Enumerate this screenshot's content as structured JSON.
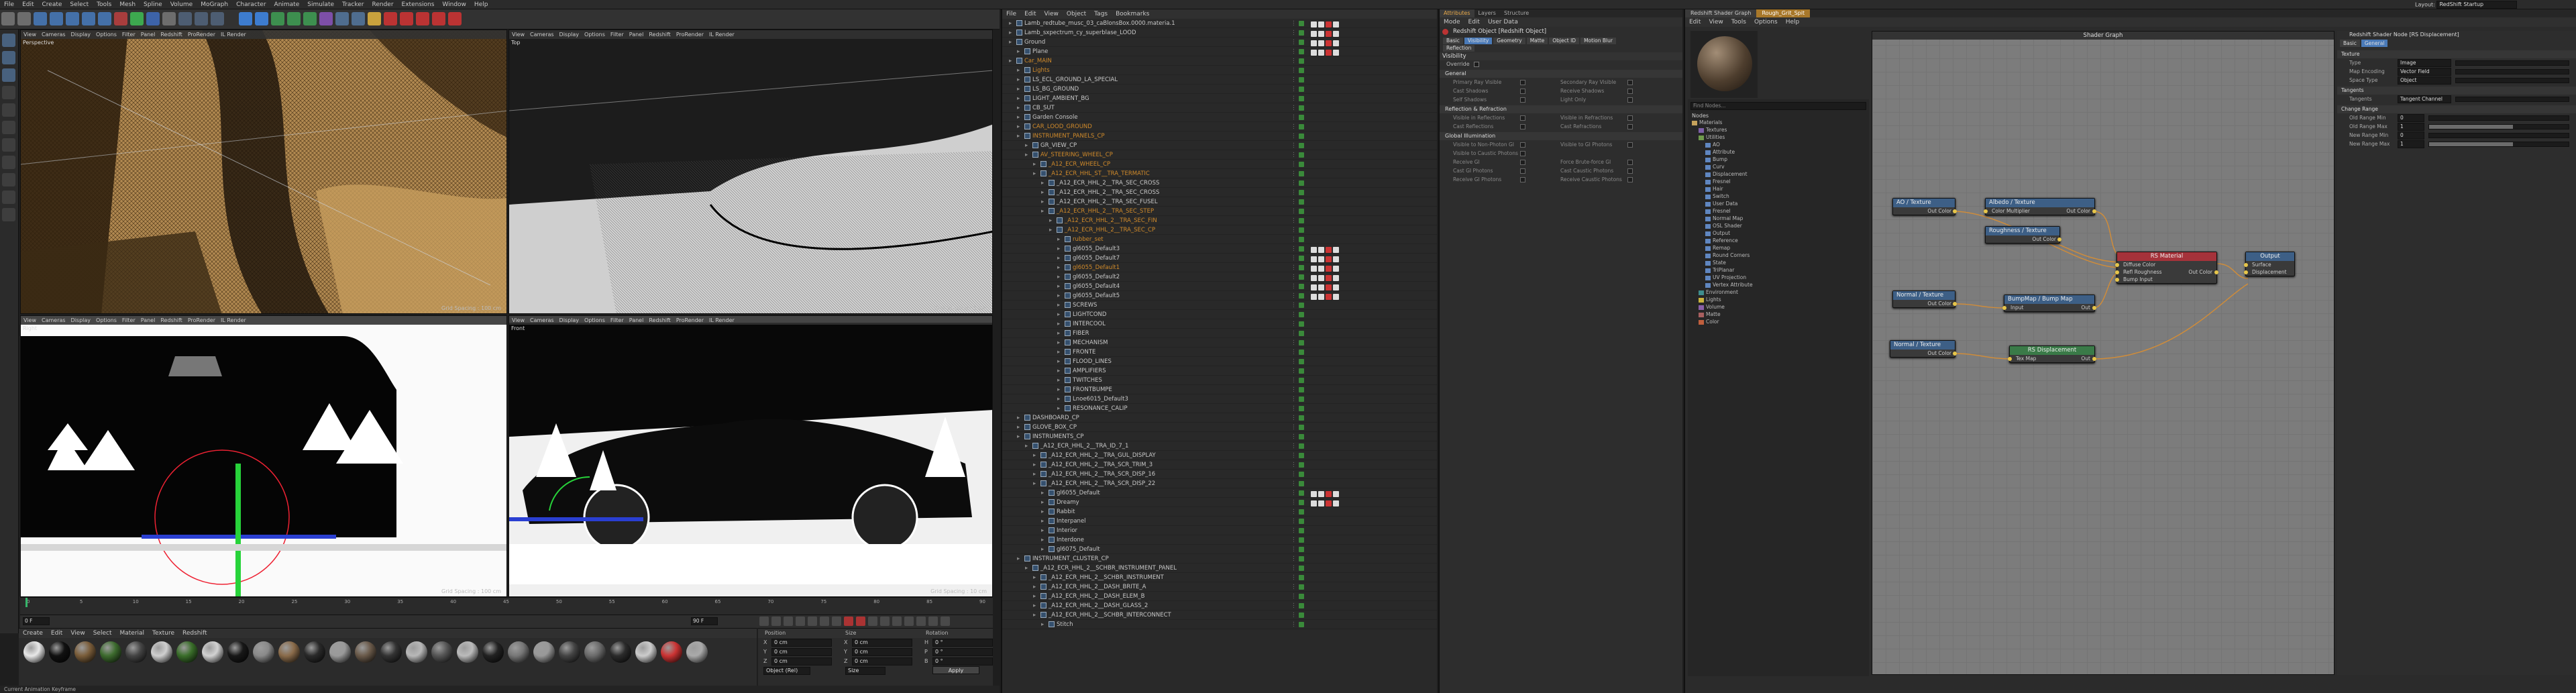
{
  "menus": {
    "main": [
      "File",
      "Edit",
      "Create",
      "Select",
      "Tools",
      "Mesh",
      "Spline",
      "Volume",
      "MoGraph",
      "Character",
      "Animate",
      "Simulate",
      "Tracker",
      "Render",
      "Extensions",
      "Window",
      "Help"
    ],
    "layout_label": "Layout:",
    "layout_value": "RedShift Startup"
  },
  "viewports": {
    "menu": [
      "View",
      "Cameras",
      "Display",
      "Options",
      "Filter",
      "Panel",
      "Redshift",
      "ProRender",
      "IL Render"
    ],
    "v1": {
      "label": "Perspective",
      "grid": "Grid Spacing : 100 cm"
    },
    "v2": {
      "label": "Top",
      "grid": "Grid Spacing : 1 cm"
    },
    "v3": {
      "label": "Right",
      "grid": "Grid Spacing : 100 cm"
    },
    "v4": {
      "label": "Front",
      "grid": "Grid Spacing : 10 cm"
    }
  },
  "timeline": {
    "start": "0 F",
    "end": "90 F",
    "current": "0 F",
    "ticks": [
      "0",
      "5",
      "10",
      "15",
      "20",
      "25",
      "30",
      "35",
      "40",
      "45",
      "50",
      "55",
      "60",
      "65",
      "70",
      "75",
      "80",
      "85",
      "90"
    ]
  },
  "material_manager": {
    "menu": [
      "Create",
      "Edit",
      "View",
      "Select",
      "Material",
      "Texture",
      "Redshift"
    ]
  },
  "coordinates": {
    "headers": [
      "Position",
      "Size",
      "Rotation"
    ],
    "rows": [
      [
        "X",
        "0 cm",
        "X",
        "0 cm",
        "H",
        "0 °"
      ],
      [
        "Y",
        "0 cm",
        "Y",
        "0 cm",
        "P",
        "0 °"
      ],
      [
        "Z",
        "0 cm",
        "Z",
        "0 cm",
        "B",
        "0 °"
      ]
    ],
    "mode": "Object (Rel)",
    "size_mode": "Size",
    "apply": "Apply"
  },
  "status": {
    "text": "Current Animation Keyframe"
  },
  "objects": {
    "menu": [
      "File",
      "Edit",
      "View",
      "Object",
      "Tags",
      "Bookmarks"
    ],
    "rows": [
      {
        "name": "Lamb_redtube_musc_03_caBlonsBox.0000.materia.1",
        "depth": 0,
        "c": "w"
      },
      {
        "name": "Lamb_sxpectrum_cy_superblase_LOOD",
        "depth": 0,
        "c": "w"
      },
      {
        "name": "Ground",
        "depth": 0,
        "c": "w"
      },
      {
        "name": "Plane",
        "depth": 1,
        "c": "w"
      },
      {
        "name": "Car_MAIN",
        "depth": 0,
        "c": "o"
      },
      {
        "name": "Lights",
        "depth": 1,
        "c": "o"
      },
      {
        "name": "LS_ECL_GROUND_LA_SPECIAL",
        "depth": 1,
        "c": "w"
      },
      {
        "name": "LS_BG_GROUND",
        "depth": 1,
        "c": "w"
      },
      {
        "name": "LIGHT_AMBIENT_BG",
        "depth": 1,
        "c": "w"
      },
      {
        "name": "CB_SUT",
        "depth": 1,
        "c": "w"
      },
      {
        "name": "Garden Console",
        "depth": 1,
        "c": "w"
      },
      {
        "name": "CAR_LOOD_GROUND",
        "depth": 1,
        "c": "o"
      },
      {
        "name": "INSTRUMENT_PANELS_CP",
        "depth": 1,
        "c": "o"
      },
      {
        "name": "GR_VIEW_CP",
        "depth": 2,
        "c": "w"
      },
      {
        "name": "AV_STEERING_WHEEL_CP",
        "depth": 2,
        "c": "o"
      },
      {
        "name": "_A12_ECR_WHEEL_CP",
        "depth": 3,
        "c": "o"
      },
      {
        "name": "_A12_ECR_HHL_ST__TRA_TERMATIC",
        "depth": 3,
        "c": "o"
      },
      {
        "name": "_A12_ECR_HHL_2__TRA_SEC_CROSS",
        "depth": 4,
        "c": "w"
      },
      {
        "name": "_A12_ECR_HHL_2__TRA_SEC_CROSS",
        "depth": 4,
        "c": "w"
      },
      {
        "name": "_A12_ECR_HHL_2__TRA_SEC_FUSEL",
        "depth": 4,
        "c": "w"
      },
      {
        "name": "_A12_ECR_HHL_2__TRA_SEC_STEP",
        "depth": 4,
        "c": "o"
      },
      {
        "name": "_A12_ECR_HHL_2__TRA_SEC_FIN",
        "depth": 5,
        "c": "o"
      },
      {
        "name": "_A12_ECR_HHL_2__TRA_SEC_CP",
        "depth": 5,
        "c": "o"
      },
      {
        "name": "rubber_set",
        "depth": 6,
        "c": "o"
      },
      {
        "name": "gl6055_Default3",
        "depth": 6,
        "c": "w"
      },
      {
        "name": "gl6055_Default7",
        "depth": 6,
        "c": "w"
      },
      {
        "name": "gl6055_Default1",
        "depth": 6,
        "c": "o"
      },
      {
        "name": "gl6055_Default2",
        "depth": 6,
        "c": "w"
      },
      {
        "name": "gl6055_Default4",
        "depth": 6,
        "c": "w"
      },
      {
        "name": "gl6055_Default5",
        "depth": 6,
        "c": "w"
      },
      {
        "name": "SCREWS",
        "depth": 6,
        "c": "w"
      },
      {
        "name": "LIGHTCOND",
        "depth": 6,
        "c": "w"
      },
      {
        "name": "INTERCOOL",
        "depth": 6,
        "c": "w"
      },
      {
        "name": "FIBER",
        "depth": 6,
        "c": "w"
      },
      {
        "name": "MECHANISM",
        "depth": 6,
        "c": "w"
      },
      {
        "name": "FRONTE",
        "depth": 6,
        "c": "w"
      },
      {
        "name": "FLOOD_LINES",
        "depth": 6,
        "c": "w"
      },
      {
        "name": "AMPLIFIERS",
        "depth": 6,
        "c": "w"
      },
      {
        "name": "TWITCHES",
        "depth": 6,
        "c": "w"
      },
      {
        "name": "FRONTBUMPE",
        "depth": 6,
        "c": "w"
      },
      {
        "name": "Lnoe6015_Default3",
        "depth": 6,
        "c": "w"
      },
      {
        "name": "RESONANCE_CALIP",
        "depth": 6,
        "c": "w"
      },
      {
        "name": "DASHBOARD_CP",
        "depth": 1,
        "c": "w"
      },
      {
        "name": "GLOVE_BOX_CP",
        "depth": 1,
        "c": "w"
      },
      {
        "name": "INSTRUMENTS_CP",
        "depth": 1,
        "c": "w"
      },
      {
        "name": "_A12_ECR_HHL_2__TRA_ID_7_1",
        "depth": 2,
        "c": "w"
      },
      {
        "name": "_A12_ECR_HHL_2__TRA_GUL_DISPLAY",
        "depth": 3,
        "c": "w"
      },
      {
        "name": "_A12_ECR_HHL_2__TRA_SCR_TRIM_3",
        "depth": 3,
        "c": "w"
      },
      {
        "name": "_A12_ECR_HHL_2__TRA_SCR_DISP_16",
        "depth": 3,
        "c": "w"
      },
      {
        "name": "_A12_ECR_HHL_2__TRA_SCR_DISP_22",
        "depth": 3,
        "c": "w"
      },
      {
        "name": "gl6055_Default",
        "depth": 4,
        "c": "w"
      },
      {
        "name": "Dreamy",
        "depth": 4,
        "c": "w"
      },
      {
        "name": "Rabbit",
        "depth": 4,
        "c": "w"
      },
      {
        "name": "Interpanel",
        "depth": 4,
        "c": "w"
      },
      {
        "name": "Interior",
        "depth": 4,
        "c": "w"
      },
      {
        "name": "Interdone",
        "depth": 4,
        "c": "w"
      },
      {
        "name": "gl6075_Default",
        "depth": 4,
        "c": "w"
      },
      {
        "name": "INSTRUMENT_CLUSTER_CP",
        "depth": 1,
        "c": "w"
      },
      {
        "name": "_A12_ECR_HHL_2__SCHBR_INSTRUMENT_PANEL",
        "depth": 2,
        "c": "w"
      },
      {
        "name": "_A12_ECR_HHL_2__SCHBR_INSTRUMENT",
        "depth": 3,
        "c": "w"
      },
      {
        "name": "_A12_ECR_HHL_2__DASH_BRITE_A",
        "depth": 3,
        "c": "w"
      },
      {
        "name": "_A12_ECR_HHL_2__DASH_ELEM_B",
        "depth": 3,
        "c": "w"
      },
      {
        "name": "_A12_ECR_HHL_2__DASH_GLASS_2",
        "depth": 3,
        "c": "w"
      },
      {
        "name": "_A12_ECR_HHL_2__SCHBR_INTERCONNECT",
        "depth": 3,
        "c": "w"
      },
      {
        "name": "Stitch",
        "depth": 4,
        "c": "w"
      }
    ]
  },
  "attributes": {
    "tabs": [
      "Attributes",
      "Layers",
      "Structure"
    ],
    "menu": [
      "Mode",
      "Edit",
      "User Data"
    ],
    "title": "Redshift Object [Redshift Object]",
    "subtabs": [
      "Basic",
      "Visibility",
      "Geometry",
      "Matte",
      "Object ID",
      "Motion Blur"
    ],
    "subtab2": [
      "Reflection"
    ],
    "section": "Visibility",
    "override_label": "Override",
    "groups": [
      {
        "title": "General",
        "fields": [
          [
            "Primary Ray Visible",
            "Secondary Ray Visible"
          ],
          [
            "Cast Shadows",
            "Receive Shadows"
          ],
          [
            "Self Shadows",
            "Light Only"
          ]
        ]
      },
      {
        "title": "Reflection & Refraction",
        "fields": [
          [
            "Visible in Reflections",
            "Visible in Refractions"
          ],
          [
            "Cast Reflections",
            "Cast Refractions"
          ]
        ]
      },
      {
        "title": "Global Illumination",
        "fields": [
          [
            "Visible to Non-Photon GI",
            "Visible to GI Photons"
          ],
          [
            "Visible to Caustic Photons",
            ""
          ],
          [
            "Receive GI",
            "Force Brute-force GI"
          ],
          [
            "Cast GI Photons",
            "Cast Caustic Photons"
          ],
          [
            "Receive GI Photons",
            "Receive Caustic Photons"
          ]
        ]
      }
    ]
  },
  "material_editor": {
    "tabs": [
      "Redshift Shader Graph",
      "Rough_Grit_Spit"
    ],
    "menu": [
      "Edit",
      "View",
      "Tools",
      "Options",
      "Help"
    ],
    "find_placeholder": "Find Nodes...",
    "tree_title": "Nodes",
    "tree": [
      "Materials",
      "Textures",
      "Utilities",
      "AO",
      "Attribute",
      "Bump",
      "Curv",
      "Displacement",
      "Fresnel",
      "Hair",
      "Switch",
      "User Data",
      "Fresnel",
      "Normal Map",
      "OSL Shader",
      "Output",
      "Reference",
      "Remap",
      "Round Corners",
      "State",
      "TriPlanar",
      "UV Projection",
      "Vertex Attribute",
      "Environment",
      "Lights",
      "Volume",
      "Matte",
      "Color"
    ],
    "graph_title": "Shader Graph",
    "nodes": {
      "ao": {
        "title": "AO / Texture",
        "out": "Out Color"
      },
      "albedo": {
        "title": "Albedo / Texture",
        "in": "Color Multiplier",
        "out": "Out Color"
      },
      "rough": {
        "title": "Roughness / Texture",
        "out": "Out Color"
      },
      "material": {
        "title": "RS Material",
        "ports": [
          "Diffuse Color",
          "Refl Roughness",
          "Bump Input"
        ],
        "out": "Out Color"
      },
      "output": {
        "title": "Output",
        "ports": [
          "Surface",
          "Displacement"
        ]
      },
      "normal": {
        "title": "Normal / Texture",
        "out": "Out Color"
      },
      "bumpmap": {
        "title": "BumpMap / Bump Map",
        "in": "Input",
        "out": "Out"
      },
      "normal2": {
        "title": "Normal / Texture",
        "out": "Out Color"
      },
      "disp": {
        "title": "RS Displacement",
        "in": "Tex Map",
        "out": "Out"
      }
    }
  },
  "properties": {
    "title": "Redshift Shader Node [RS Displacement]",
    "tabs": [
      "Basic",
      "General"
    ],
    "group1": "Texture",
    "fields1": [
      [
        "Type",
        "Image"
      ],
      [
        "Map Encoding",
        "Vector Field"
      ],
      [
        "Space Type",
        "Object"
      ]
    ],
    "group2": "Tangents",
    "fields2": [
      [
        "Tangents",
        "Tangent Channel"
      ]
    ],
    "group3": "Change Range",
    "fields3": [
      [
        "Old Range Min",
        "0",
        0.0
      ],
      [
        "Old Range Max",
        "1",
        0.6
      ],
      [
        "New Range Min",
        "0",
        0.0
      ],
      [
        "New Range Max",
        "1",
        0.6
      ]
    ]
  },
  "colors": {
    "accent": "#d08a2a",
    "node_header_blue": "#3d5f86",
    "node_header_red": "#a5323a",
    "node_header_green": "#3a7a48",
    "wire": "#cf8c3a"
  }
}
